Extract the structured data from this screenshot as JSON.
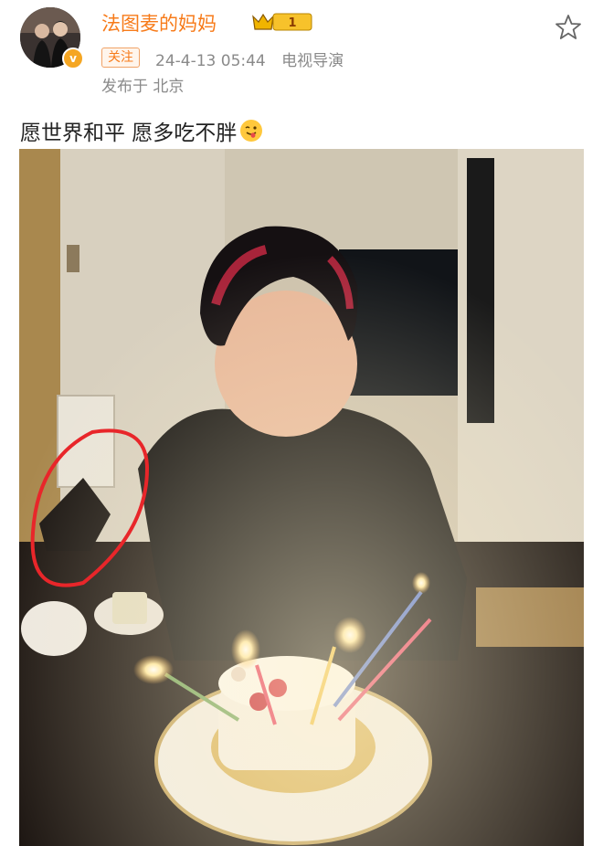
{
  "post": {
    "author": {
      "name": "法图麦的妈妈",
      "level_badge": "1",
      "follow_label": "关注",
      "timestamp": "24-4-13 05:44",
      "source": "电视导演",
      "location": "发布于 北京"
    },
    "text": "愿世界和平 愿多吃不胖",
    "emoji": "tongue-wink-emoji",
    "favorite_icon": "star-outline-icon",
    "colors": {
      "username": "#f77b1a",
      "meta": "#8a8a8a",
      "annotation_circle": "#e8262a"
    }
  }
}
